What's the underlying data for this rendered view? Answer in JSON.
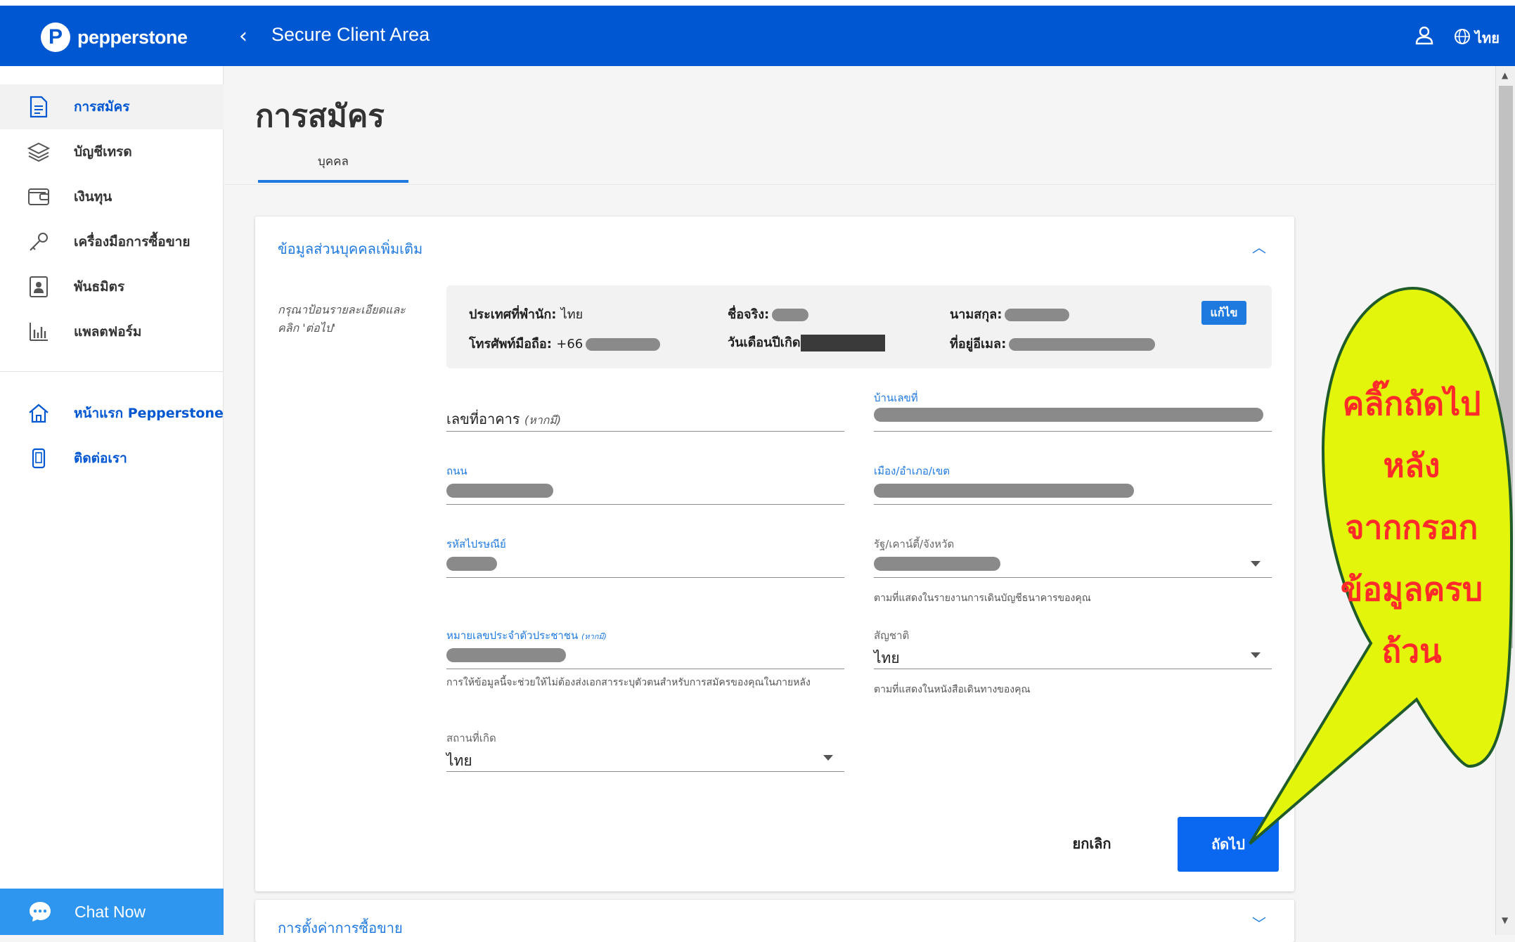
{
  "header": {
    "brand": "pepperstone",
    "title": "Secure Client Area",
    "language": "ไทย",
    "bg_color": "#0057d2"
  },
  "sidebar": {
    "items": [
      {
        "label": "การสมัคร",
        "icon": "document-icon",
        "active": true
      },
      {
        "label": "บัญชีเทรด",
        "icon": "layers-icon"
      },
      {
        "label": "เงินทุน",
        "icon": "wallet-icon"
      },
      {
        "label": "เครื่องมือการซื้อขาย",
        "icon": "key-icon"
      },
      {
        "label": "พันธมิตร",
        "icon": "contact-card-icon"
      },
      {
        "label": "แพลตฟอร์ม",
        "icon": "bar-chart-icon"
      }
    ],
    "links": [
      {
        "label": "หน้าแรก Pepperstone",
        "icon": "home-icon"
      },
      {
        "label": "ติดต่อเรา",
        "icon": "phone-icon"
      }
    ],
    "chat_label": "Chat Now"
  },
  "main": {
    "page_title": "การสมัคร",
    "tabs": [
      {
        "label": "บุคคล",
        "active": true
      }
    ],
    "section": {
      "title": "ข้อมูลส่วนบุคคลเพิ่มเติม",
      "instruction": "กรุณาป้อนรายละเอียดและคลิก 'ต่อไป'",
      "summary": {
        "country_label": "ประเทศที่พำนัก:",
        "country_value": "ไทย",
        "first_name_label": "ชื่อจริง:",
        "last_name_label": "นามสกุล:",
        "mobile_label": "โทรศัพท์มือถือ:",
        "mobile_value": "+66",
        "dob_label": "วันเดือนปีเกิด",
        "email_label": "ที่อยู่อีเมล:",
        "edit_label": "แก้ไข"
      },
      "fields": {
        "building": {
          "placeholder": "เลขที่อาคาร",
          "optional": "(หากมี)"
        },
        "house_no": {
          "label": "บ้านเลขที่"
        },
        "street": {
          "label": "ถนน"
        },
        "city": {
          "label": "เมือง/อำเภอ/เขต"
        },
        "postcode": {
          "label": "รหัสไปรษณีย์"
        },
        "state": {
          "label": "รัฐ/เคาน์ตี้/จังหวัด",
          "helper": "ตามที่แสดงในรายงานการเดินบัญชีธนาคารของคุณ"
        },
        "national_id": {
          "label": "หมายเลขประจำตัวประชาชน",
          "optional": "(หากมี)",
          "helper": "การให้ข้อมูลนี้จะช่วยให้ไม่ต้องส่งเอกสารระบุตัวตนสำหรับการสมัครของคุณในภายหลัง"
        },
        "nationality": {
          "label": "สัญชาติ",
          "value": "ไทย",
          "helper": "ตามที่แสดงในหนังสือเดินทางของคุณ"
        },
        "birthplace": {
          "label": "สถานที่เกิด",
          "value": "ไทย"
        }
      },
      "cancel_label": "ยกเลิก",
      "next_label": "ถัดไป"
    },
    "section2_title": "การตั้งค่าการซื้อขาย"
  },
  "callout": {
    "lines": [
      "คลิ๊กถัดไป",
      "หลัง",
      "จากกรอก",
      "ข้อมูลครบ",
      "ถ้วน"
    ],
    "fill_color": "#e2f50a",
    "text_color": "#ff2a2a"
  }
}
